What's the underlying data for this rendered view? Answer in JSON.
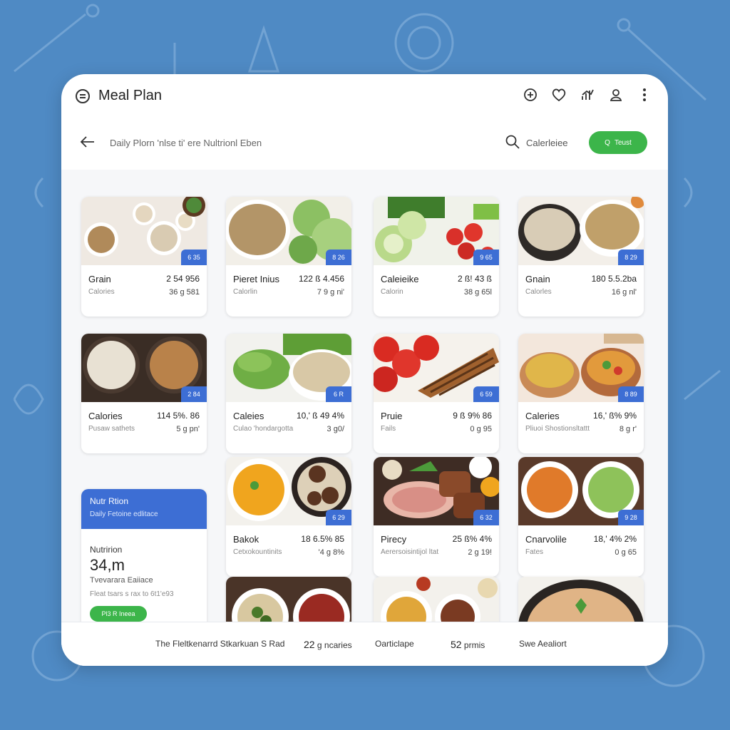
{
  "app": {
    "title": "Meal Plan"
  },
  "top_icons": [
    "plus-circle-icon",
    "heart-icon",
    "chart-icon",
    "user-icon",
    "more-icon"
  ],
  "subbar": {
    "breadcrumb": "Daily Plorn 'nlse  ti' ere Nultrionl Eben",
    "search_text": "Calerleiee",
    "button_label": "Teust",
    "button_icon": "Q"
  },
  "cards": [
    {
      "name": "Grain",
      "sub": "Calories",
      "val1": "2 54 956",
      "val2": "36 g 581",
      "badge": "6 35",
      "img": "grains"
    },
    {
      "name": "Pieret Inius",
      "sub": "Calorlin",
      "val1": "122 ß 4.456",
      "val2": "7 9 g ni'",
      "badge": "8 26",
      "img": "lentil-cabbage"
    },
    {
      "name": "Caleieike",
      "sub": "Calorin",
      "val1": "2 ß! 43 ß",
      "val2": "38 g 65l",
      "badge": "9 65",
      "img": "veggies"
    },
    {
      "name": "Gnain",
      "sub": "Calorles",
      "val1": "180 5.5.2ba",
      "val2": "16 g nl'",
      "badge": "8 29",
      "img": "grain-bowls"
    },
    {
      "name": "Calories",
      "sub": "Pusaw sathets",
      "val1": "114 5%. 86",
      "val2": "5 g pn'",
      "badge": "2 84",
      "img": "rice-bowls"
    },
    {
      "name": "Caleies",
      "sub": "Culao 'hondargotta",
      "val1": "10,' ß 49 4%",
      "val2": "3 g0/",
      "badge": "6 R",
      "img": "greens"
    },
    {
      "name": "Pruie",
      "sub": "Fails",
      "val1": "9 ß 9% 86",
      "val2": "0 g 95",
      "badge": "6 59",
      "img": "chicken"
    },
    {
      "name": "Caleries",
      "sub": "Pliuoi Shostionsltattt",
      "val1": "16,' ß% 9%",
      "val2": "8 g r'",
      "badge": "8 89",
      "img": "chickpea"
    },
    {
      "name": "Bakok",
      "sub": "Cetxokountinits",
      "val1": "18 6.5% 85",
      "val2": "'4 g 8%",
      "badge": "6 29",
      "img": "squash-meat"
    },
    {
      "name": "Pirecy",
      "sub": "Aerersoisintijol ltat",
      "val1": "25 ß% 4%",
      "val2": "2 g 19!",
      "badge": "6 32",
      "img": "meat-plate"
    },
    {
      "name": "Cnarvolile",
      "sub": "Fates",
      "val1": "18,' 4% 2%",
      "val2": "0 g 65",
      "badge": "9 28",
      "img": "chickpea-salad"
    },
    {
      "name": "",
      "sub": "",
      "val1": "",
      "val2": "",
      "badge": "",
      "img": "sprouts"
    },
    {
      "name": "",
      "sub": "",
      "val1": "",
      "val2": "",
      "badge": "",
      "img": "curry"
    },
    {
      "name": "",
      "sub": "",
      "val1": "",
      "val2": "",
      "badge": "",
      "img": "pan"
    }
  ],
  "panel": {
    "title": "Nutr Rtion",
    "subtitle": "Daily Fetoine edlitace",
    "label": "Nutririon",
    "big_value": "34,m",
    "line1": "Tvevarara Eaiiace",
    "line2": "Fleat tsars s rax to 6t1'e93",
    "button": "Pl3 R Ineea"
  },
  "footer": {
    "item1": "The Fleltkenarrd Stkarkuan S Rad",
    "val1": "22",
    "unit1": "g ncaries",
    "item2": "Oarticlape",
    "val2": "52",
    "unit2": "prmis",
    "item3": "Swe Aealiort"
  },
  "colors": {
    "background": "#4f8ac4",
    "accent_blue": "#3d6ed4",
    "accent_green": "#3cb54a"
  }
}
